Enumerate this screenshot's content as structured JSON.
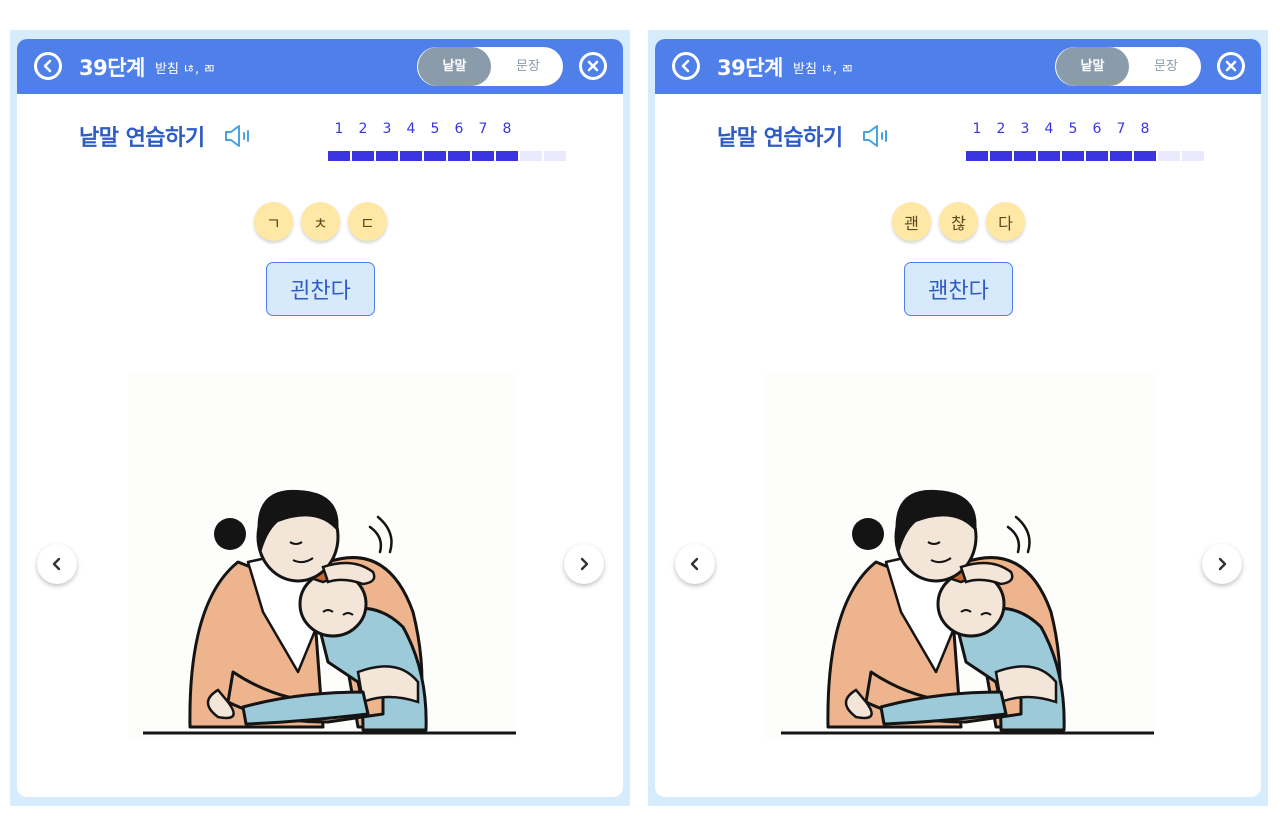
{
  "panels": [
    {
      "header": {
        "stage_title": "39단계",
        "subtitle": "받침 ㄶ, ㄻ",
        "toggle_active": "낱말",
        "toggle_inactive": "문장"
      },
      "practice_title": "낱말 연습하기",
      "progress": {
        "numbers": [
          "1",
          "2",
          "3",
          "4",
          "5",
          "6",
          "7",
          "8"
        ],
        "completed": 8,
        "total": 10
      },
      "chips": [
        "ㄱ",
        "ㅊ",
        "ㄷ"
      ],
      "word": "괸찬다"
    },
    {
      "header": {
        "stage_title": "39단계",
        "subtitle": "받침 ㄶ, ㄻ",
        "toggle_active": "낱말",
        "toggle_inactive": "문장"
      },
      "practice_title": "낱말 연습하기",
      "progress": {
        "numbers": [
          "1",
          "2",
          "3",
          "4",
          "5",
          "6",
          "7",
          "8"
        ],
        "completed": 8,
        "total": 10
      },
      "chips": [
        "괜",
        "찮",
        "다"
      ],
      "word": "괜찬다"
    }
  ],
  "colors": {
    "header": "#4f7fe8",
    "panel_border": "#d6ebfb",
    "progress": "#3a35e0",
    "chip": "#ffe7a6",
    "word_box": "#d7eafc"
  },
  "icons": {
    "back": "chevron-left-circle-icon",
    "close": "x-circle-icon",
    "speaker": "speaker-icon",
    "prev": "chevron-left-icon",
    "next": "chevron-right-icon"
  }
}
